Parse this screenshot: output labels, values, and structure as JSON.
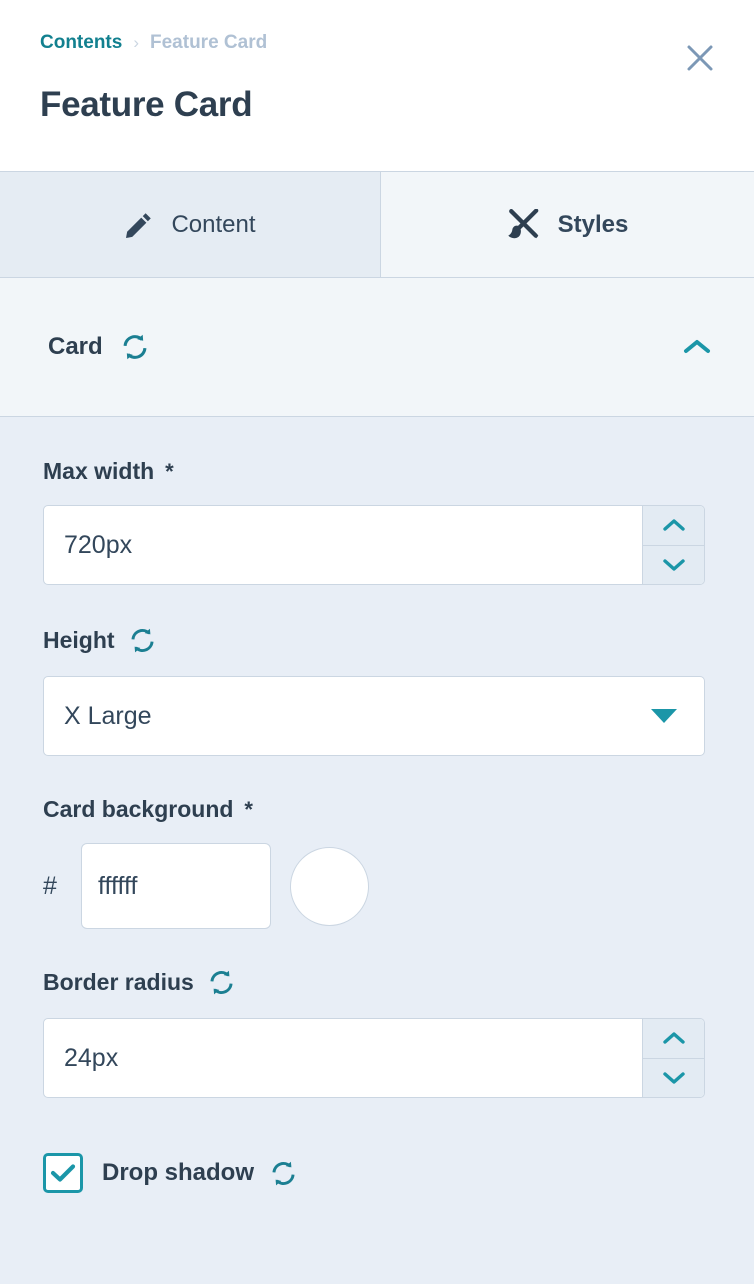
{
  "header": {
    "breadcrumb": {
      "parent": "Contents",
      "separator": "›",
      "current": "Feature Card"
    },
    "title": "Feature Card",
    "close_icon": "close-icon",
    "close_label": "Close"
  },
  "tabs": [
    {
      "label": "Content",
      "icon": "pencil-icon",
      "active": false
    },
    {
      "label": "Styles",
      "icon": "paintbrush-icon",
      "active": true
    }
  ],
  "section": {
    "title": "Card",
    "reset_icon": "refresh-icon",
    "collapse_icon": "chevron-up-icon",
    "expanded": true
  },
  "fields": {
    "max_width": {
      "label": "Max width",
      "required_marker": "*",
      "value": "720px",
      "placeholder": "",
      "increment_icon": "chevron-up-icon",
      "decrement_icon": "chevron-down-icon"
    },
    "height": {
      "label": "Height",
      "reset_icon": "refresh-icon",
      "value": "X Large",
      "caret_icon": "caret-down-icon"
    },
    "card_background": {
      "label": "Card background",
      "required_marker": "*",
      "hash_prefix": "#",
      "value": "ffffff",
      "placeholder": "",
      "swatch_color": "#ffffff",
      "swatch_icon": "color-swatch"
    },
    "border_radius": {
      "label": "Border radius",
      "reset_icon": "refresh-icon",
      "value": "24px",
      "placeholder": "",
      "increment_icon": "chevron-up-icon",
      "decrement_icon": "chevron-down-icon"
    },
    "drop_shadow": {
      "label": "Drop shadow",
      "checked": true,
      "check_icon": "checkmark-icon",
      "reset_icon": "refresh-icon"
    }
  },
  "colors": {
    "accent_teal": "#1b96a8",
    "link_teal": "#12808f",
    "text_dark": "#2e3f50",
    "muted_blue": "#7c98b6",
    "crumb_muted": "#b0c1d4",
    "panel_bg": "#e8eef6",
    "section_bg": "#f2f6f9",
    "border": "#cbd6e2"
  }
}
